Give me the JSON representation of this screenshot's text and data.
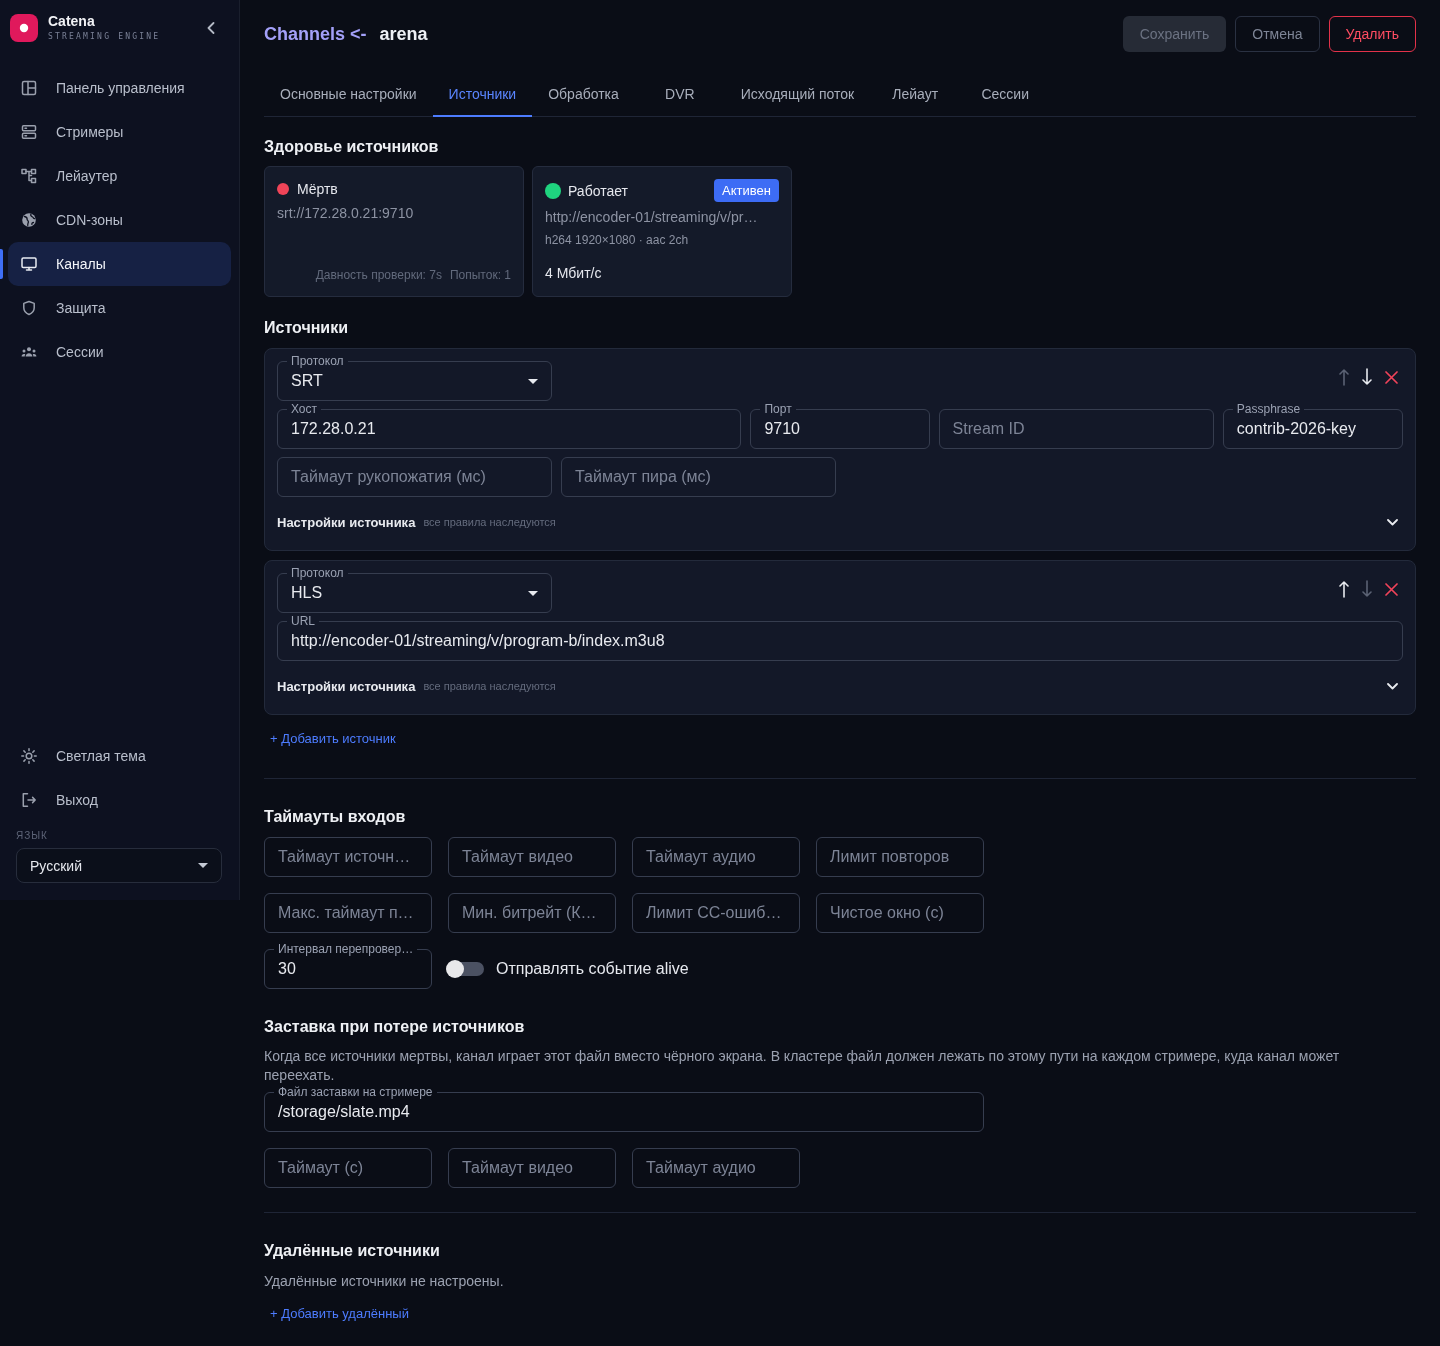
{
  "sidebar": {
    "brand": {
      "name": "Catena",
      "tagline": "STREAMING ENGINE"
    },
    "nav": [
      {
        "kind": "dashboard",
        "label": "Панель управления",
        "selected": false
      },
      {
        "kind": "servers",
        "label": "Стримеры",
        "selected": false
      },
      {
        "kind": "layouter",
        "label": "Лейаутер",
        "selected": false
      },
      {
        "kind": "globe",
        "label": "CDN-зоны",
        "selected": false
      },
      {
        "kind": "monitor",
        "label": "Каналы",
        "selected": true
      },
      {
        "kind": "shield",
        "label": "Защита",
        "selected": false
      },
      {
        "kind": "users",
        "label": "Сессии",
        "selected": false
      }
    ],
    "footer": [
      {
        "kind": "theme",
        "label": "Светлая тема"
      },
      {
        "kind": "logout",
        "label": "Выход"
      }
    ],
    "language": {
      "label": "ЯЗЫК",
      "value": "Русский"
    }
  },
  "header": {
    "breadcrumb": "Channels <-",
    "title": "arena",
    "buttons": [
      {
        "kind": "primary",
        "label": "Сохранить",
        "disabled": true
      },
      {
        "kind": "outline",
        "label": "Отмена",
        "disabled": false
      },
      {
        "kind": "danger",
        "label": "Удалить",
        "disabled": false
      }
    ]
  },
  "tabs": [
    {
      "label": "Основные настройки",
      "selected": false
    },
    {
      "label": "Источники",
      "selected": true
    },
    {
      "label": "Обработка",
      "selected": false
    },
    {
      "label": "DVR",
      "selected": false
    },
    {
      "label": "Исходящий поток",
      "selected": false
    },
    {
      "label": "Лейаут",
      "selected": false
    },
    {
      "label": "Сессии",
      "selected": false
    }
  ],
  "health": {
    "title": "Здоровье источников",
    "cards": [
      {
        "status": "Мёртв",
        "color": "#f04458",
        "active": false,
        "url": "srt://172.28.0.21:9710",
        "footer": [
          "Давность проверки: 7s",
          "Попыток: 1"
        ]
      },
      {
        "status": "Работает",
        "color": "#1fd47f",
        "active": true,
        "badge": "Активен",
        "url": "http://encoder-01/streaming/v/pr…",
        "codec": "h264 1920×1080 · aac 2ch",
        "bitrate": "4 Мбит/с"
      }
    ]
  },
  "sources": {
    "title": "Источники",
    "items": [
      {
        "protocol": {
          "label": "Протокол",
          "value": "SRT"
        },
        "actions": [
          {
            "kind": "up",
            "disabled": true
          },
          {
            "kind": "down",
            "disabled": false
          },
          {
            "kind": "remove",
            "disabled": false
          }
        ],
        "rows": [
          [
            {
              "label": "Хост",
              "value": "172.28.0.21"
            },
            {
              "label": "Порт",
              "value": "9710"
            },
            {
              "placeholder": "Stream ID"
            },
            {
              "label": "Passphrase",
              "value": "contrib-2026-key"
            }
          ],
          [
            {
              "placeholder": "Таймаут рукопожатия (мс)"
            },
            {
              "placeholder": "Таймаут пира (мс)"
            }
          ]
        ],
        "settings": {
          "title": "Настройки источника",
          "hint": "все правила наследуются",
          "expanded": false
        }
      },
      {
        "protocol": {
          "label": "Протокол",
          "value": "HLS"
        },
        "actions": [
          {
            "kind": "up",
            "disabled": false
          },
          {
            "kind": "down",
            "disabled": true
          },
          {
            "kind": "remove",
            "disabled": false
          }
        ],
        "rows": [
          [
            {
              "label": "URL",
              "value": "http://encoder-01/streaming/v/program-b/index.m3u8"
            }
          ]
        ],
        "settings": {
          "title": "Настройки источника",
          "hint": "все правила наследуются",
          "expanded": false
        }
      }
    ],
    "add": "+ Добавить источник"
  },
  "timeouts": {
    "title": "Таймауты входов",
    "fields": [
      {
        "placeholder": "Таймаут источн…"
      },
      {
        "placeholder": "Таймаут видео"
      },
      {
        "placeholder": "Таймаут аудио"
      },
      {
        "placeholder": "Лимит повторов"
      },
      {
        "placeholder": "Макс. таймаут п…"
      },
      {
        "placeholder": "Мин. битрейт (К…"
      },
      {
        "placeholder": "Лимит CC-ошиб…"
      },
      {
        "placeholder": "Чистое окно (с)"
      }
    ],
    "interval": {
      "label": "Интервал перепровер…",
      "value": "30"
    },
    "toggle": {
      "label": "Отправлять событие alive",
      "on": false
    }
  },
  "fallback": {
    "title": "Заставка при потере источников",
    "description": "Когда все источники мертвы, канал играет этот файл вместо чёрного экрана. В кластере файл должен лежать по этому пути на каждом стримере, куда канал может переехать.",
    "file": {
      "label": "Файл заставки на стримере",
      "value": "/storage/slate.mp4"
    },
    "fields": [
      {
        "placeholder": "Таймаут (с)"
      },
      {
        "placeholder": "Таймаут видео"
      },
      {
        "placeholder": "Таймаут аудио"
      }
    ]
  },
  "remote": {
    "title": "Удалённые источники",
    "empty": "Удалённые источники не настроены.",
    "add": "+ Добавить удалённый"
  }
}
